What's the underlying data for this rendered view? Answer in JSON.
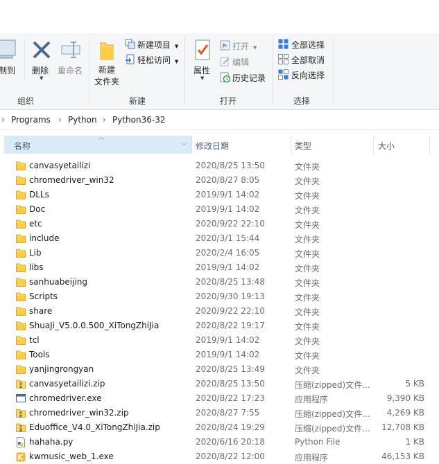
{
  "ribbon": {
    "clipboard": {
      "copy_to_label": "复制到",
      "delete_label": "删除",
      "rename_label": "重命名",
      "group_label": "组织"
    },
    "new": {
      "new_item_label": "新建项目",
      "easy_access_label": "轻松访问",
      "new_folder_line1": "新建",
      "new_folder_line2": "文件夹",
      "group_label": "新建"
    },
    "open": {
      "properties_label": "属性",
      "open_label": "打开",
      "edit_label": "编辑",
      "history_label": "历史记录",
      "group_label": "打开"
    },
    "select": {
      "select_all_label": "全部选择",
      "select_none_label": "全部取消",
      "invert_label": "反向选择",
      "group_label": "选择"
    }
  },
  "breadcrumb": [
    "Programs",
    "Python",
    "Python36-32"
  ],
  "columns": {
    "name": "名称",
    "date": "修改日期",
    "type": "类型",
    "size": "大小"
  },
  "files": [
    {
      "name": "canvasyetailizi",
      "date": "2020/8/25 13:50",
      "type": "文件夹",
      "size": "",
      "icon": "folder-icon"
    },
    {
      "name": "chromedriver_win32",
      "date": "2020/8/27 8:05",
      "type": "文件夹",
      "size": "",
      "icon": "folder-icon"
    },
    {
      "name": "DLLs",
      "date": "2019/9/1 14:02",
      "type": "文件夹",
      "size": "",
      "icon": "folder-icon"
    },
    {
      "name": "Doc",
      "date": "2019/9/1 14:02",
      "type": "文件夹",
      "size": "",
      "icon": "folder-icon"
    },
    {
      "name": "etc",
      "date": "2020/9/22 22:10",
      "type": "文件夹",
      "size": "",
      "icon": "folder-icon"
    },
    {
      "name": "include",
      "date": "2020/3/1 15:44",
      "type": "文件夹",
      "size": "",
      "icon": "folder-icon"
    },
    {
      "name": "Lib",
      "date": "2020/2/4 16:05",
      "type": "文件夹",
      "size": "",
      "icon": "folder-icon"
    },
    {
      "name": "libs",
      "date": "2019/9/1 14:02",
      "type": "文件夹",
      "size": "",
      "icon": "folder-icon"
    },
    {
      "name": "sanhuabeijing",
      "date": "2020/8/25 13:48",
      "type": "文件夹",
      "size": "",
      "icon": "folder-icon"
    },
    {
      "name": "Scripts",
      "date": "2020/9/30 19:13",
      "type": "文件夹",
      "size": "",
      "icon": "folder-icon"
    },
    {
      "name": "share",
      "date": "2020/9/22 22:10",
      "type": "文件夹",
      "size": "",
      "icon": "folder-icon"
    },
    {
      "name": "ShuaJi_V5.0.0.500_XiTongZhiJia",
      "date": "2020/8/22 19:17",
      "type": "文件夹",
      "size": "",
      "icon": "folder-icon"
    },
    {
      "name": "tcl",
      "date": "2019/9/1 14:02",
      "type": "文件夹",
      "size": "",
      "icon": "folder-icon"
    },
    {
      "name": "Tools",
      "date": "2019/9/1 14:02",
      "type": "文件夹",
      "size": "",
      "icon": "folder-icon"
    },
    {
      "name": "yanjingrongyan",
      "date": "2020/8/25 13:49",
      "type": "文件夹",
      "size": "",
      "icon": "folder-icon"
    },
    {
      "name": "canvasyetailizi.zip",
      "date": "2020/8/25 13:50",
      "type": "压缩(zipped)文件...",
      "size": "5 KB",
      "icon": "zip-icon"
    },
    {
      "name": "chromedriver.exe",
      "date": "2020/8/22 17:23",
      "type": "应用程序",
      "size": "9,390 KB",
      "icon": "exe-icon"
    },
    {
      "name": "chromedriver_win32.zip",
      "date": "2020/8/27 7:55",
      "type": "压缩(zipped)文件...",
      "size": "4,269 KB",
      "icon": "zip-icon"
    },
    {
      "name": "Eduoffice_V4.0_XiTongZhiJia.zip",
      "date": "2020/8/24 19:29",
      "type": "压缩(zipped)文件...",
      "size": "12,708 KB",
      "icon": "zip-icon"
    },
    {
      "name": "hahaha.py",
      "date": "2020/6/16 20:18",
      "type": "Python File",
      "size": "1 KB",
      "icon": "python-file-icon"
    },
    {
      "name": "kwmusic_web_1.exe",
      "date": "2020/8/22 12:00",
      "type": "应用程序",
      "size": "46,153 KB",
      "icon": "kwmusic-icon"
    }
  ],
  "colors": {
    "header_highlight": "#d9ebf9",
    "folder": "#ffd866",
    "accent": "#1e73c8"
  }
}
